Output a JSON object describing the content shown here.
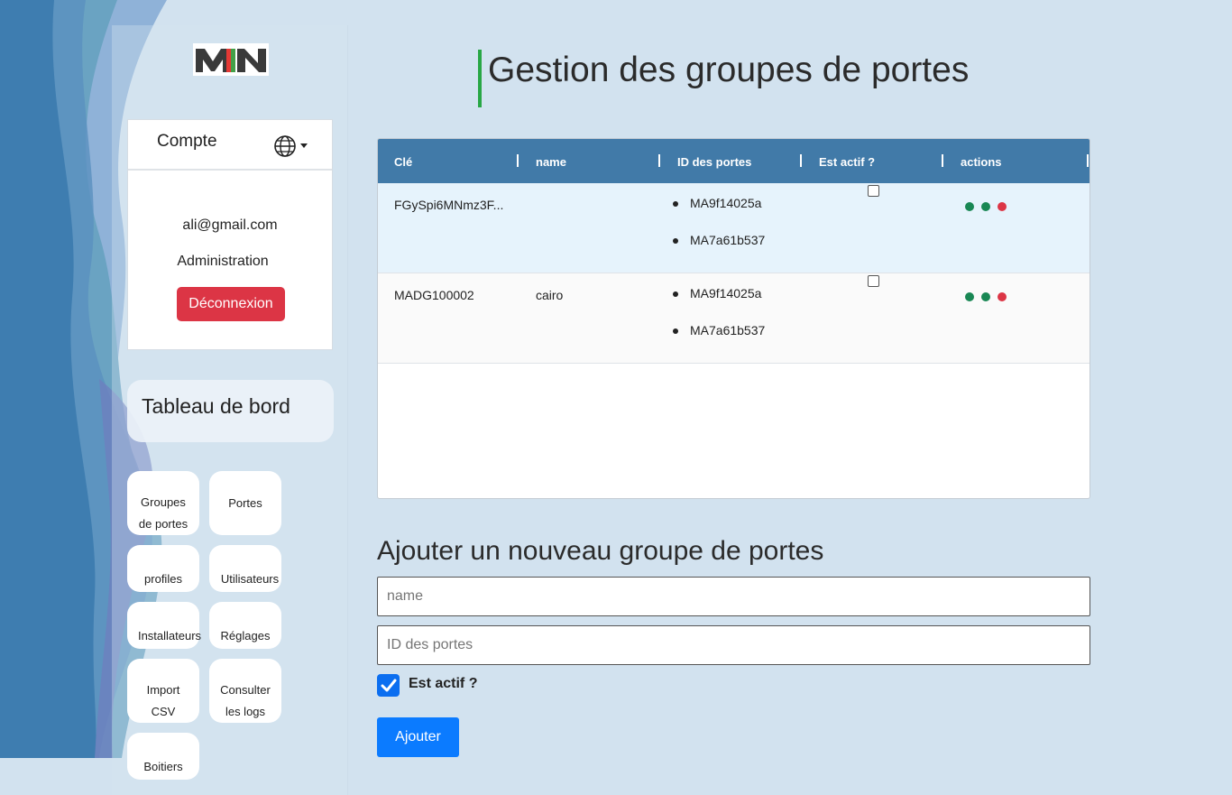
{
  "brand": {
    "logo_text": "MN"
  },
  "account": {
    "title": "Compte",
    "email": "ali@gmail.com",
    "role": "Administration",
    "logout_label": "Déconnexion"
  },
  "dashboard_label": "Tableau de bord",
  "nav": {
    "groups": [
      "Groupes",
      "de portes"
    ],
    "doors": "Portes",
    "profiles": "profiles",
    "users": "Utilisateurs",
    "installers": "Installateurs",
    "settings": "Réglages",
    "import": [
      "Import",
      "CSV"
    ],
    "logs": [
      "Consulter",
      "les logs"
    ],
    "boxes": "Boitiers"
  },
  "page_title": "Gestion des groupes de portes",
  "table": {
    "columns": [
      "Clé",
      "name",
      "ID des portes",
      "Est actif ?",
      "actions"
    ],
    "rows": [
      {
        "key": "FGySpi6MNmz3F...",
        "name": "",
        "ports": [
          "MA9f14025a",
          "MA7a61b537"
        ],
        "active": false
      },
      {
        "key": "MADG100002",
        "name": "cairo",
        "ports": [
          "MA9f14025a",
          "MA7a61b537"
        ],
        "active": false
      }
    ]
  },
  "form": {
    "title": "Ajouter un nouveau groupe de portes",
    "name_placeholder": "name",
    "ports_placeholder": "ID des portes",
    "active_label": "Est actif ?",
    "active_checked": true,
    "submit_label": "Ajouter"
  },
  "colors": {
    "header_blue": "#417aa8",
    "row_highlight": "#e6f3fc",
    "danger": "#dc3545",
    "primary": "#0b7bff",
    "success": "#198754",
    "title_accent": "#28a745"
  }
}
